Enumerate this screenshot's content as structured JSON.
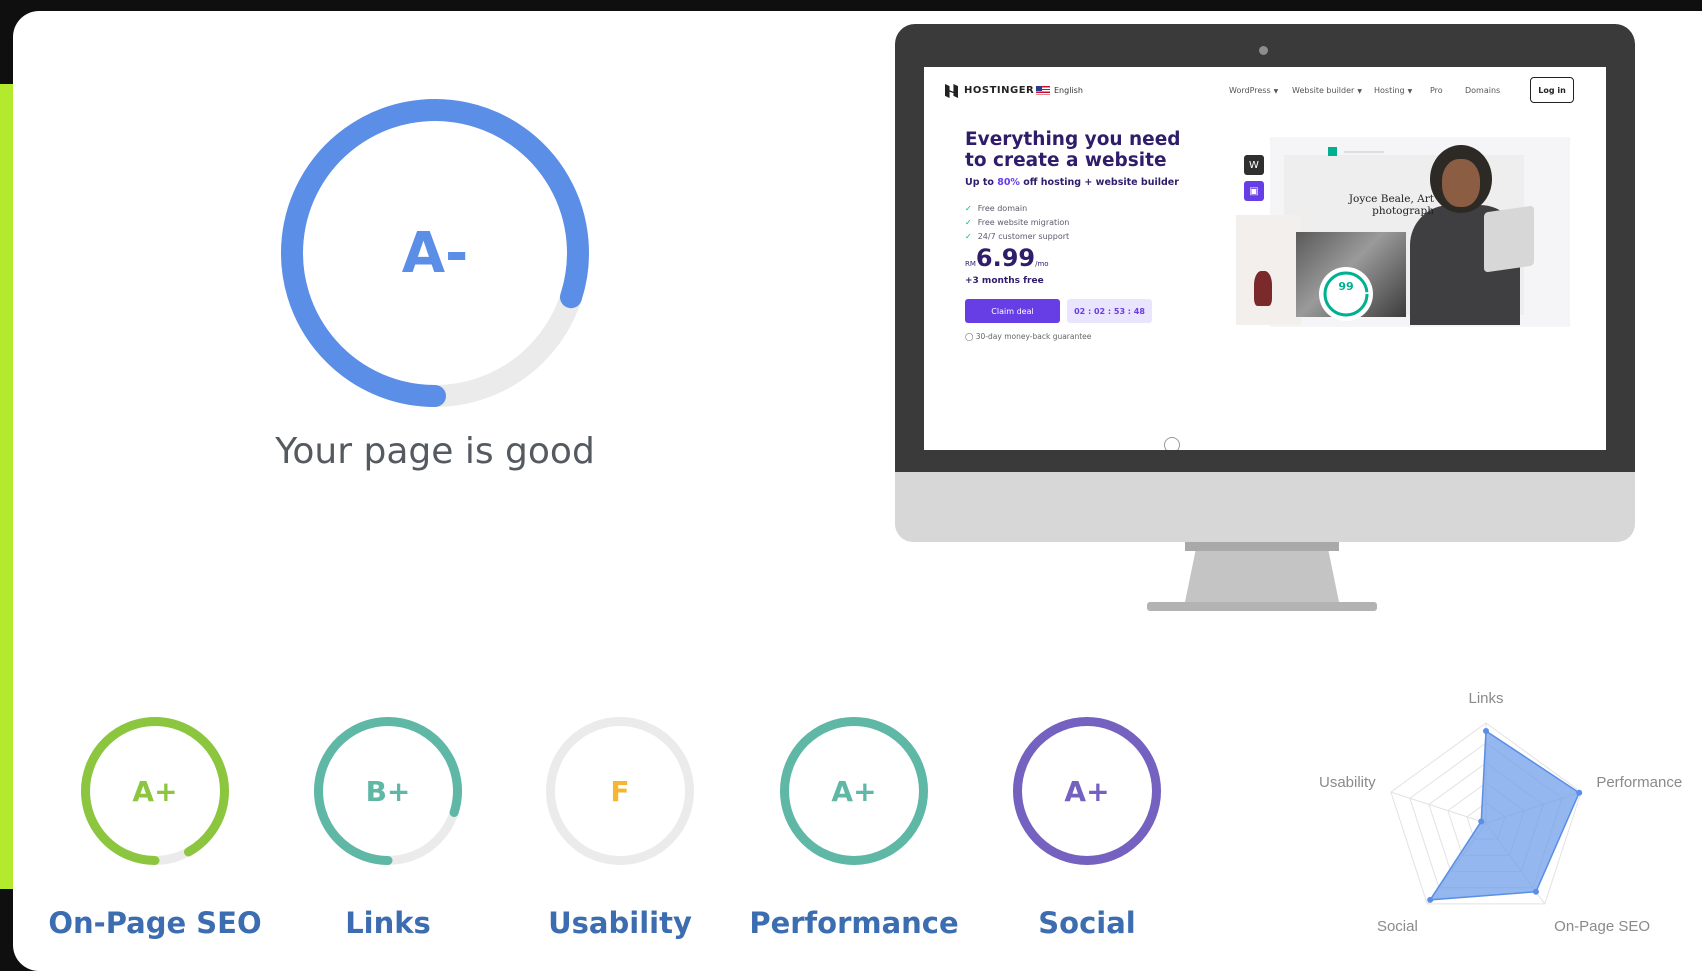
{
  "overall": {
    "grade": "A-",
    "progress": 0.8,
    "color": "#5b8ee6",
    "track_color": "#ebebeb",
    "message": "Your page is good"
  },
  "categories": [
    {
      "label": "On-Page SEO",
      "grade": "A+",
      "progress": 0.92,
      "color": "#8cc63f",
      "text_color": "#8cc63f"
    },
    {
      "label": "Links",
      "grade": "B+",
      "progress": 0.8,
      "color": "#5fb7a5",
      "text_color": "#5fb7a5"
    },
    {
      "label": "Usability",
      "grade": "F",
      "progress": 0.0,
      "color": "#f5b631",
      "text_color": "#f5b631"
    },
    {
      "label": "Performance",
      "grade": "A+",
      "progress": 1.0,
      "color": "#5fb7a5",
      "text_color": "#5fb7a5"
    },
    {
      "label": "Social",
      "grade": "A+",
      "progress": 1.0,
      "color": "#7461c0",
      "text_color": "#7461c0"
    }
  ],
  "label_color": "#3c6db0",
  "radar": {
    "axes": [
      "Links",
      "Performance",
      "On-Page SEO",
      "Social",
      "Usability"
    ],
    "values": [
      0.92,
      0.98,
      0.85,
      0.95,
      0.05
    ],
    "fill_color": "#6f9fe8",
    "stroke_color": "#5b8ee6"
  },
  "screenshot": {
    "brand": "HOSTINGER",
    "language": "English",
    "nav_items": [
      "WordPress",
      "Website builder",
      "Hosting",
      "Pro",
      "Domains"
    ],
    "nav_dropdowns": [
      true,
      true,
      true,
      false,
      false
    ],
    "login": "Log in",
    "hero_title": "Everything you need to create a website",
    "offer_prefix": "Up to ",
    "offer_pct": "80%",
    "offer_suffix": " off hosting + website builder",
    "features": [
      "Free domain",
      "Free website migration",
      "24/7 customer support"
    ],
    "price_currency": "RM",
    "price_amount": "6.99",
    "price_period": "/mo",
    "bonus": "+3 months free",
    "cta": "Claim deal",
    "timer": "02 : 02 : 53 : 48",
    "guarantee": "30-day money-back guarantee",
    "photo_caption": "Joyce Beale, Art photograph",
    "perf_score": "99"
  }
}
